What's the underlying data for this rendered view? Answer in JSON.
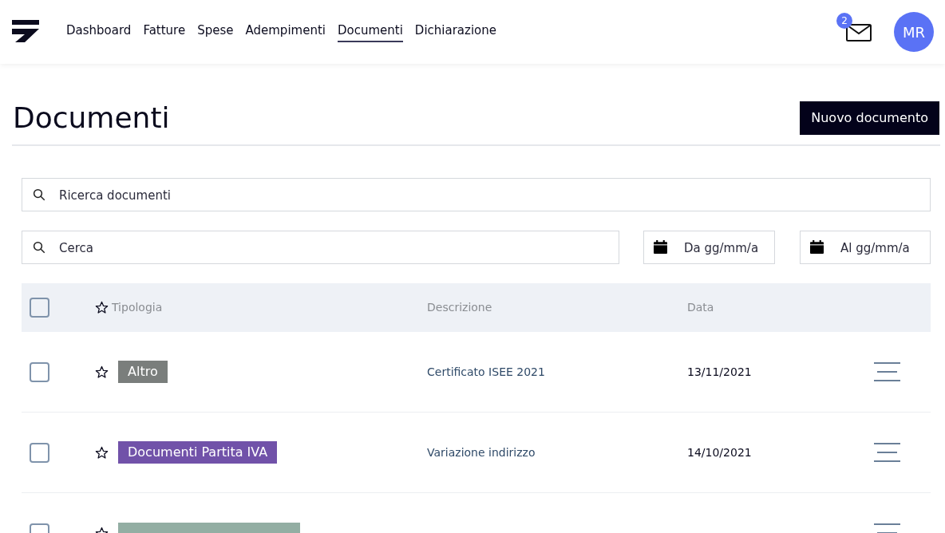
{
  "nav": {
    "links": [
      {
        "label": "Dashboard",
        "selected": false
      },
      {
        "label": "Fatture",
        "selected": false
      },
      {
        "label": "Spese",
        "selected": false
      },
      {
        "label": "Adempimenti",
        "selected": false
      },
      {
        "label": "Documenti",
        "selected": true
      },
      {
        "label": "Dichiarazione",
        "selected": false
      }
    ],
    "mail_count": "2",
    "avatar": "MR"
  },
  "page": {
    "title": "Documenti",
    "new_button": "Nuovo documento"
  },
  "filters": {
    "search_placeholder": "Ricerca documenti",
    "cerca_placeholder": "Cerca",
    "from_placeholder": "Da gg/mm/a",
    "to_placeholder": "Al gg/mm/a"
  },
  "table": {
    "all_checked": false,
    "columns": [
      "Tipologia",
      "Descrizione",
      "Data"
    ],
    "rows": [
      {
        "checked": false,
        "starred": false,
        "type": "Altro",
        "color": "#7a7e7c",
        "description": "Certificato ISEE 2021",
        "date": "13/11/2021"
      },
      {
        "checked": false,
        "starred": false,
        "type": "Documenti Partita IVA",
        "color": "#7152a9",
        "description": "Variazione indirizzo",
        "date": "14/10/2021"
      },
      {
        "checked": false,
        "starred": false,
        "color": "#93aea3"
      }
    ]
  }
}
